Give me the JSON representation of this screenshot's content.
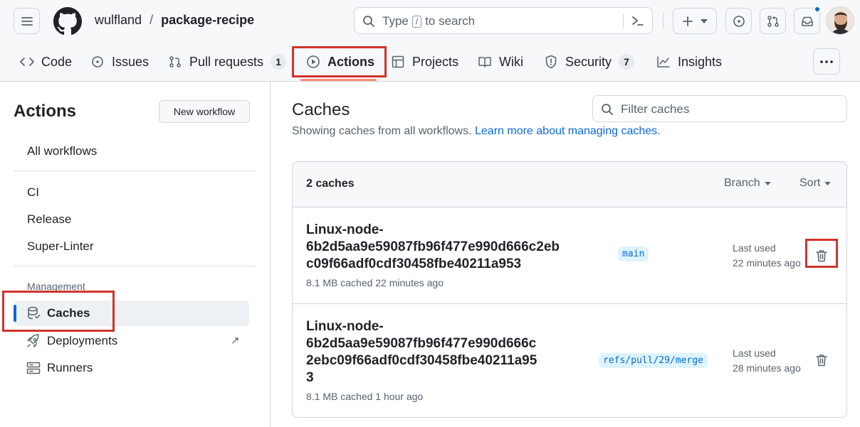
{
  "header": {
    "owner": "wulfland",
    "separator": "/",
    "repo": "package-recipe",
    "search_prefix": "Type",
    "search_key": "/",
    "search_suffix": "to search",
    "notification_dot_color": "#0969da"
  },
  "tabs": [
    {
      "label": "Code",
      "icon": "code-icon"
    },
    {
      "label": "Issues",
      "icon": "issue-icon"
    },
    {
      "label": "Pull requests",
      "icon": "pull-request-icon",
      "count": "1"
    },
    {
      "label": "Actions",
      "icon": "play-icon",
      "selected": true
    },
    {
      "label": "Projects",
      "icon": "table-icon"
    },
    {
      "label": "Wiki",
      "icon": "book-icon"
    },
    {
      "label": "Security",
      "icon": "shield-icon",
      "count": "7"
    },
    {
      "label": "Insights",
      "icon": "graph-icon"
    }
  ],
  "sidebar": {
    "title": "Actions",
    "new_workflow": "New workflow",
    "all_workflows": "All workflows",
    "workflows": [
      "CI",
      "Release",
      "Super-Linter"
    ],
    "management_heading": "Management",
    "management_items": [
      {
        "label": "Caches",
        "icon": "database-icon",
        "selected": true
      },
      {
        "label": "Deployments",
        "icon": "rocket-icon",
        "external": "↗"
      },
      {
        "label": "Runners",
        "icon": "server-icon"
      }
    ]
  },
  "main": {
    "title": "Caches",
    "filter_placeholder": "Filter caches",
    "subtitle": "Showing caches from all workflows.",
    "learn_more": "Learn more about managing caches.",
    "count_label": "2 caches",
    "branch_label": "Branch",
    "sort_label": "Sort",
    "caches": [
      {
        "key": "Linux-node-\n6b2d5aa9e59087fb96f477e990d666c2eb\nc09f66adf0cdf30458fbe40211a953",
        "meta": "8.1 MB cached 22 minutes ago",
        "branch": "main",
        "last_used_label": "Last used",
        "last_used": "22 minutes ago"
      },
      {
        "key": "Linux-node-\n6b2d5aa9e59087fb96f477e990d666c\n2ebc09f66adf0cdf30458fbe40211a95\n3",
        "meta": "8.1 MB cached 1 hour ago",
        "branch": "refs/pull/29/merge",
        "last_used_label": "Last used",
        "last_used": "28 minutes ago"
      }
    ]
  },
  "colors": {
    "accent": "#0969da",
    "highlight_box": "#d0342c",
    "selected_bar": "#0969da",
    "tab_underline": "#fd8c73"
  }
}
